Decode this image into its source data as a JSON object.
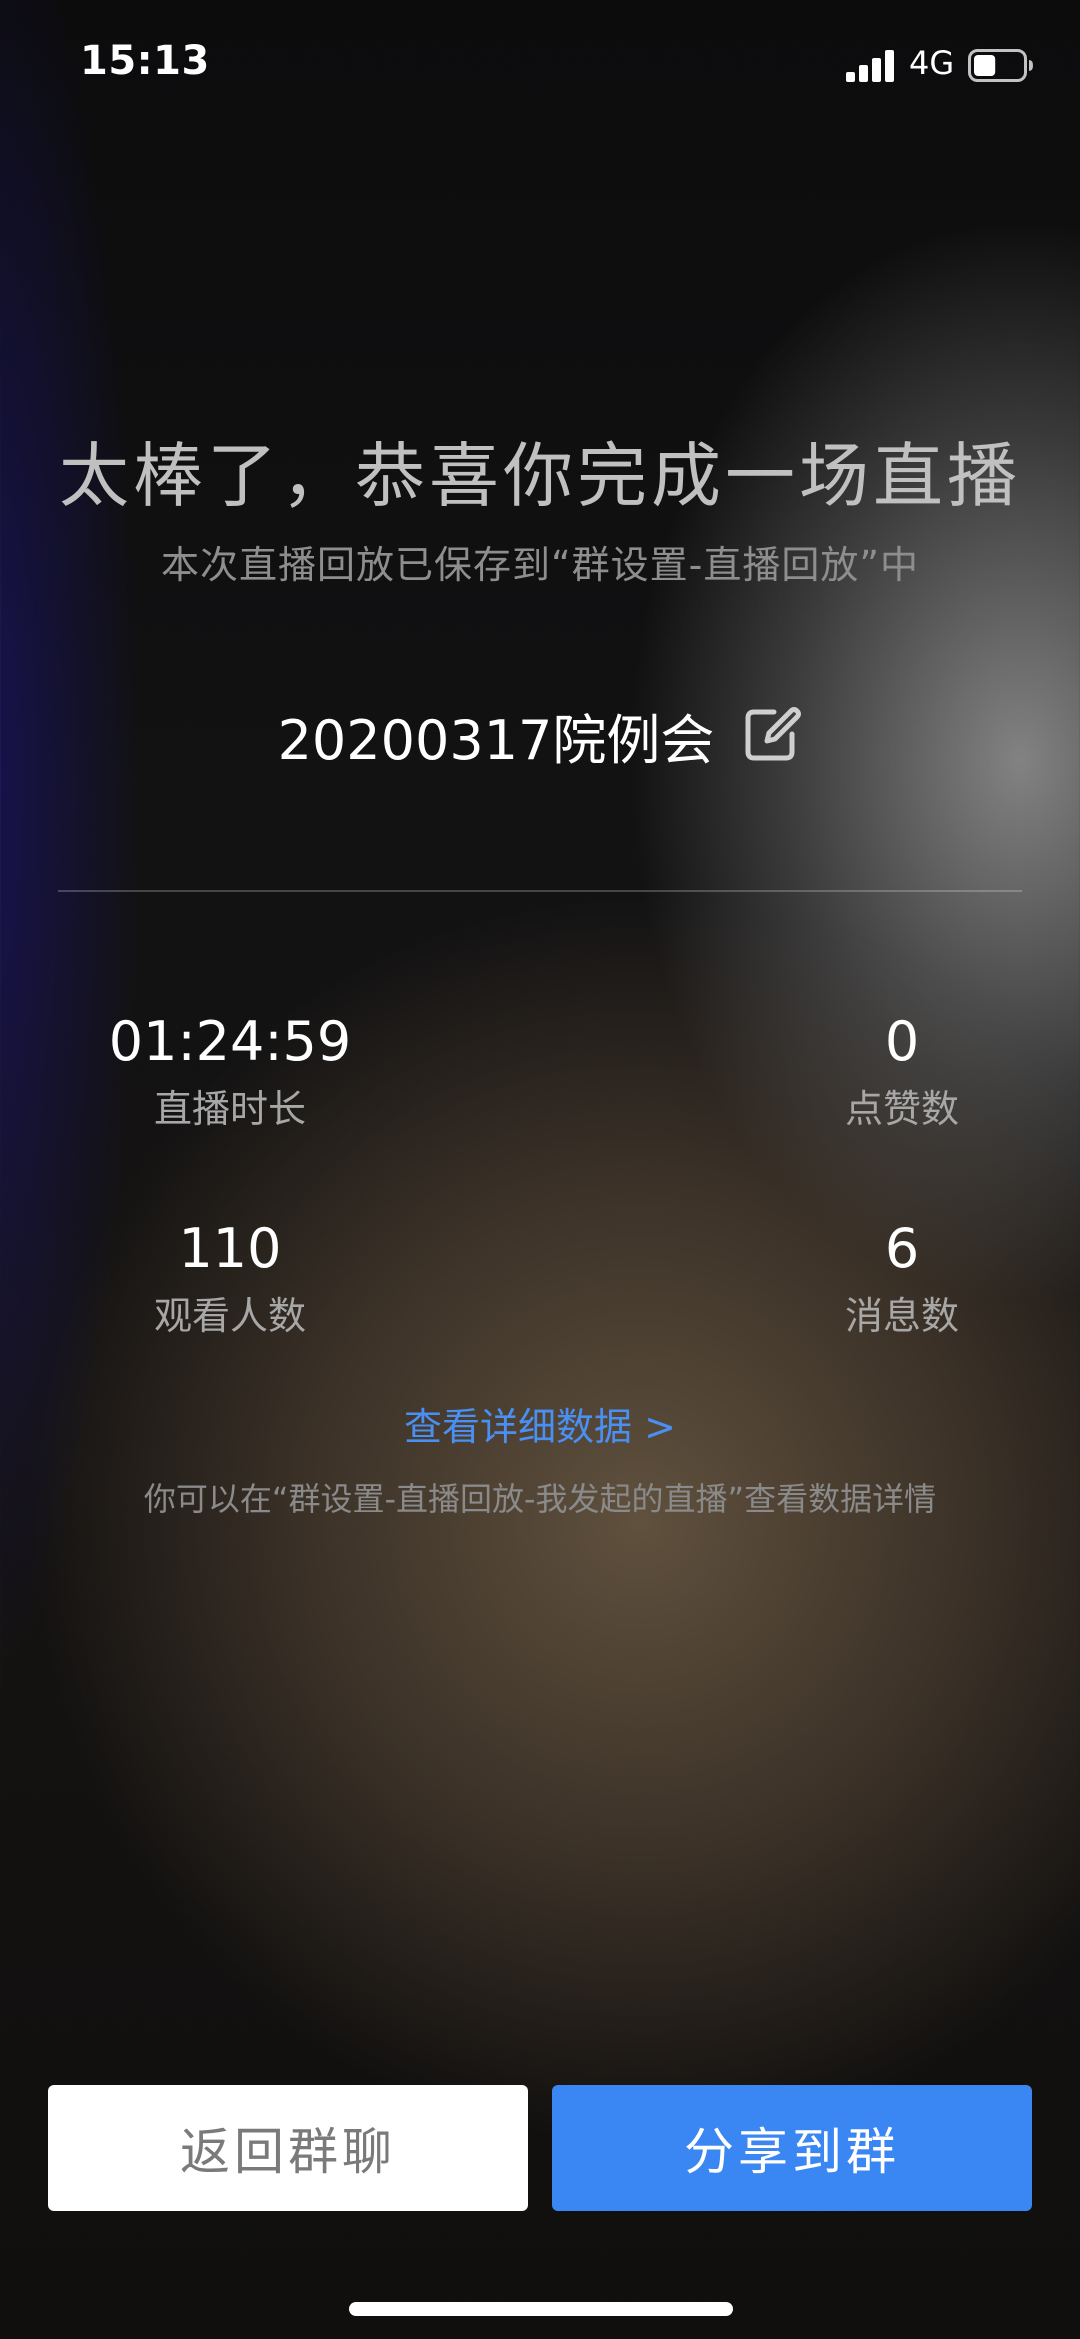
{
  "status_bar": {
    "time": "15:13",
    "network": "4G",
    "battery_level": 0.45,
    "signal_bars": 4
  },
  "header": {
    "title": "太棒了，恭喜你完成一场直播",
    "subtitle": "本次直播回放已保存到“群设置-直播回放”中"
  },
  "live": {
    "title": "20200317院例会",
    "edit_icon": "edit-icon"
  },
  "stats": [
    {
      "value": "01:24:59",
      "label": "直播时长"
    },
    {
      "value": "0",
      "label": "点赞数"
    },
    {
      "value": "110",
      "label": "观看人数"
    },
    {
      "value": "6",
      "label": "消息数"
    }
  ],
  "detail_link": "查看详细数据 >",
  "hint": "你可以在“群设置-直播回放-我发起的直播”查看数据详情",
  "buttons": {
    "back": "返回群聊",
    "share": "分享到群"
  },
  "colors": {
    "accent_blue": "#3a86f2",
    "link_blue": "#4a8ff2"
  }
}
